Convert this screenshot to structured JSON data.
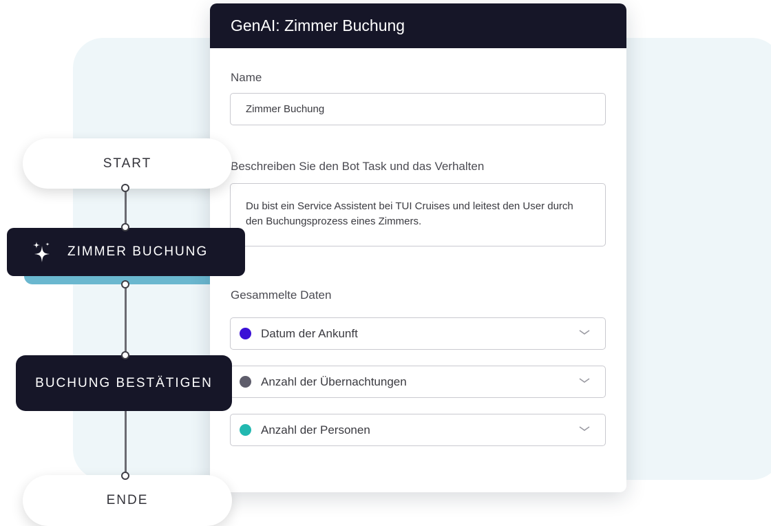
{
  "flow": {
    "start_label": "START",
    "step_label": "ZIMMER BUCHUNG",
    "confirm_label": "BUCHUNG BESTÄTIGEN",
    "end_label": "ENDE"
  },
  "card": {
    "title": "GenAI: Zimmer Buchung",
    "name_label": "Name",
    "name_value": "Zimmer Buchung",
    "description_label": "Beschreiben Sie den Bot Task und das Verhalten",
    "description_value": "Du bist ein Service Assistent bei TUI Cruises und leitest den User durch den Buchungsprozess eines Zimmers.",
    "collected_label": "Gesammelte Daten",
    "collected_items": [
      {
        "label": "Datum der Ankunft",
        "color": "#3a10d6"
      },
      {
        "label": "Anzahl der Übernachtungen",
        "color": "#5e5d6b"
      },
      {
        "label": "Anzahl der Personen",
        "color": "#22b8b0"
      }
    ]
  },
  "icons": {
    "step": "sparkle-icon",
    "dropdown": "chevron-down-icon"
  }
}
